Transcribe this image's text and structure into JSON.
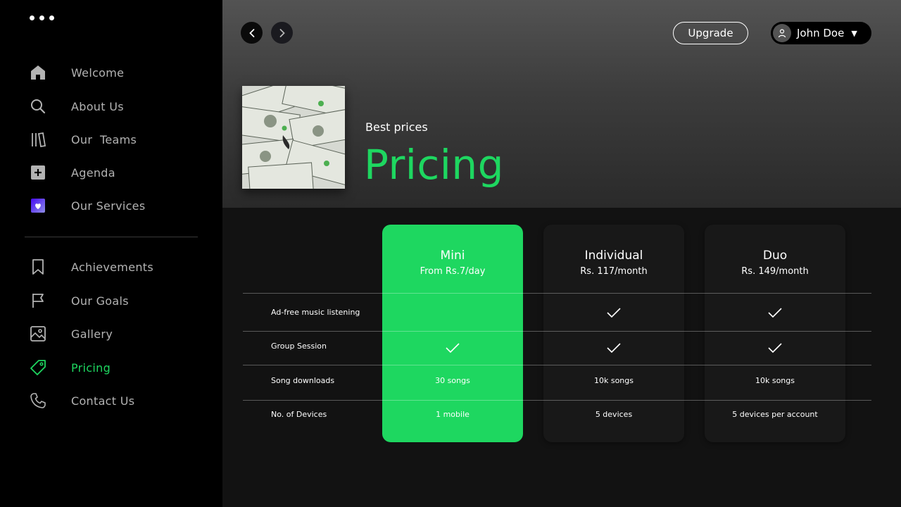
{
  "sidebar": {
    "menu_icon": "more-dots-icon",
    "items": [
      {
        "label": "Welcome",
        "icon": "home-icon"
      },
      {
        "label": "About Us",
        "icon": "search-icon"
      },
      {
        "label": "Our  Teams",
        "icon": "library-icon"
      },
      {
        "label": "Agenda",
        "icon": "plus-square-icon"
      },
      {
        "label": "Our Services",
        "icon": "heart-square-icon"
      },
      {
        "label": "Achievements",
        "icon": "bookmark-icon"
      },
      {
        "label": "Our Goals",
        "icon": "flag-icon"
      },
      {
        "label": "Gallery",
        "icon": "image-icon"
      },
      {
        "label": "Pricing",
        "icon": "tag-icon",
        "active": true
      },
      {
        "label": "Contact Us",
        "icon": "phone-icon"
      }
    ]
  },
  "header": {
    "upgrade_label": "Upgrade",
    "user_name": "John Doe"
  },
  "hero": {
    "eyebrow": "Best prices",
    "title": "Pricing",
    "cover_icon": "dollar-bills-image"
  },
  "pricing": {
    "plans": [
      {
        "name": "Mini",
        "price": "From Rs.7/day",
        "highlighted": true
      },
      {
        "name": "Individual",
        "price": "Rs. 117/month",
        "highlighted": false
      },
      {
        "name": "Duo",
        "price": "Rs. 149/month",
        "highlighted": false
      }
    ],
    "features": [
      {
        "label": "Ad-free music listening",
        "values": [
          "",
          "check",
          "check"
        ]
      },
      {
        "label": "Group Session",
        "values": [
          "check",
          "check",
          "check"
        ]
      },
      {
        "label": "Song downloads",
        "values": [
          "30 songs",
          "10k songs",
          "10k songs"
        ]
      },
      {
        "label": "No. of Devices",
        "values": [
          "1 mobile",
          "5 devices",
          "5 devices per account"
        ]
      }
    ]
  },
  "colors": {
    "accent": "#1ed760",
    "sidebar_bg": "#000000",
    "main_bg": "#121212",
    "card_bg": "#181818"
  }
}
